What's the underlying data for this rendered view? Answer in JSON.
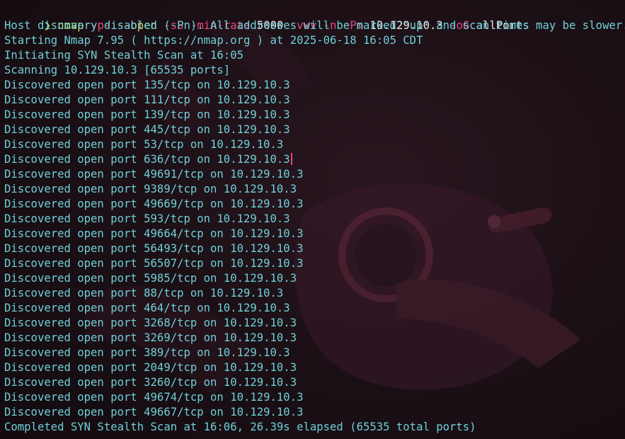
{
  "command": {
    "prompt": "❯",
    "bin": "nmap",
    "tokens": [
      {
        "t": "-p-",
        "k": "flag"
      },
      {
        "t": "--open",
        "k": "flag-alt"
      },
      {
        "t": "-sS",
        "k": "flag"
      },
      {
        "t": "-min-rate",
        "k": "flag"
      },
      {
        "t": "5000",
        "k": "arg"
      },
      {
        "t": "-vvv",
        "k": "flag"
      },
      {
        "t": "-n",
        "k": "flag"
      },
      {
        "t": "-Pn",
        "k": "flag"
      },
      {
        "t": "10.129.10.3",
        "k": "arg"
      },
      {
        "t": "-oG",
        "k": "flag"
      },
      {
        "t": "allPorts",
        "k": "arg"
      }
    ]
  },
  "output": [
    "Host discovery disabled (-Pn). All addresses will be marked 'up' and scan times may be slower.",
    "Starting Nmap 7.95 ( https://nmap.org ) at 2025-06-18 16:05 CDT",
    "Initiating SYN Stealth Scan at 16:05",
    "Scanning 10.129.10.3 [65535 ports]",
    "Discovered open port 135/tcp on 10.129.10.3",
    "Discovered open port 111/tcp on 10.129.10.3",
    "Discovered open port 139/tcp on 10.129.10.3",
    "Discovered open port 445/tcp on 10.129.10.3",
    "Discovered open port 53/tcp on 10.129.10.3",
    "Discovered open port 636/tcp on 10.129.10.3",
    "Discovered open port 49691/tcp on 10.129.10.3",
    "Discovered open port 9389/tcp on 10.129.10.3",
    "Discovered open port 49669/tcp on 10.129.10.3",
    "Discovered open port 593/tcp on 10.129.10.3",
    "Discovered open port 49664/tcp on 10.129.10.3",
    "Discovered open port 56493/tcp on 10.129.10.3",
    "Discovered open port 56507/tcp on 10.129.10.3",
    "Discovered open port 5985/tcp on 10.129.10.3",
    "Discovered open port 88/tcp on 10.129.10.3",
    "Discovered open port 464/tcp on 10.129.10.3",
    "Discovered open port 3268/tcp on 10.129.10.3",
    "Discovered open port 3269/tcp on 10.129.10.3",
    "Discovered open port 389/tcp on 10.129.10.3",
    "Discovered open port 2049/tcp on 10.129.10.3",
    "Discovered open port 3260/tcp on 10.129.10.3",
    "Discovered open port 49674/tcp on 10.129.10.3",
    "Discovered open port 49667/tcp on 10.129.10.3",
    "Completed SYN Stealth Scan at 16:06, 26.39s elapsed (65535 total ports)"
  ],
  "cursor_line_index": 9,
  "colors": {
    "output": "#6fd0d8",
    "prompt": "#b7e36a",
    "flag": "#e3477f",
    "background": "#1a1014"
  }
}
